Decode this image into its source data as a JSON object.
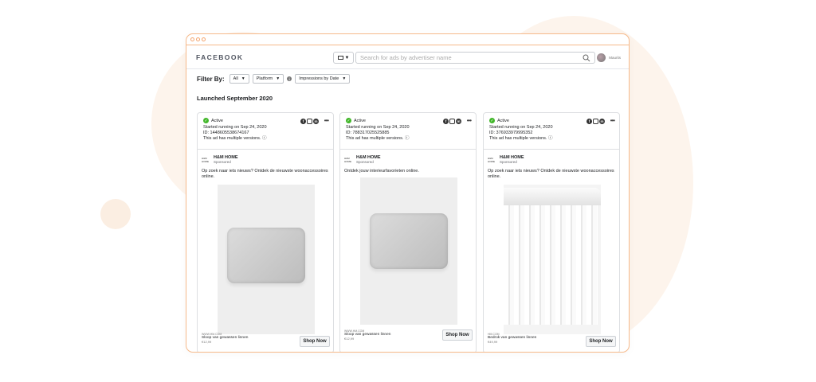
{
  "header": {
    "brand": "FACEBOOK",
    "search_placeholder": "Search for ads by advertiser name",
    "profile_name": "Maurits"
  },
  "filters": {
    "label": "Filter By:",
    "all": "All",
    "platform": "Platform",
    "sort": "Impressions by Date"
  },
  "section_title": "Launched September 2020",
  "cards": [
    {
      "status": "Active",
      "started": "Started running on Sep 24, 2020",
      "id": "ID: 1448605538674167",
      "versions": "This ad has multiple versions.",
      "advertiser": "H&M HOME",
      "advertiser_logo": "H&M HOME",
      "sponsored": "Sponsored",
      "body": "Op zoek naar iets nieuws? Ontdek de nieuwste woonaccessoires online.",
      "domain": "WWW.HM.COM",
      "product": "Sloop van gewassen linnen",
      "price": "€12,99",
      "cta": "Shop Now"
    },
    {
      "status": "Active",
      "started": "Started running on Sep 24, 2020",
      "id": "ID: 788317025525885",
      "versions": "This ad has multiple versions.",
      "advertiser": "H&M HOME",
      "advertiser_logo": "H&M HOME",
      "sponsored": "Sponsored",
      "body": "Ontdek jouw interieurfavorieten online.",
      "domain": "WWW.HM.COM",
      "product": "Sloop van gewassen linnen",
      "price": "€12,99",
      "cta": "Shop Now"
    },
    {
      "status": "Active",
      "started": "Started running on Sep 24, 2020",
      "id": "ID: 376933979995352",
      "versions": "This ad has multiple versions.",
      "advertiser": "H&M HOME",
      "advertiser_logo": "H&M HOME",
      "sponsored": "Sponsored",
      "body": "Op zoek naar iets nieuws? Ontdek de nieuwste woonaccessoires online.",
      "domain": "HM.COM",
      "product": "Bedrok van gewassen linnen",
      "price": "€49,99",
      "cta": "Shop Now"
    }
  ]
}
